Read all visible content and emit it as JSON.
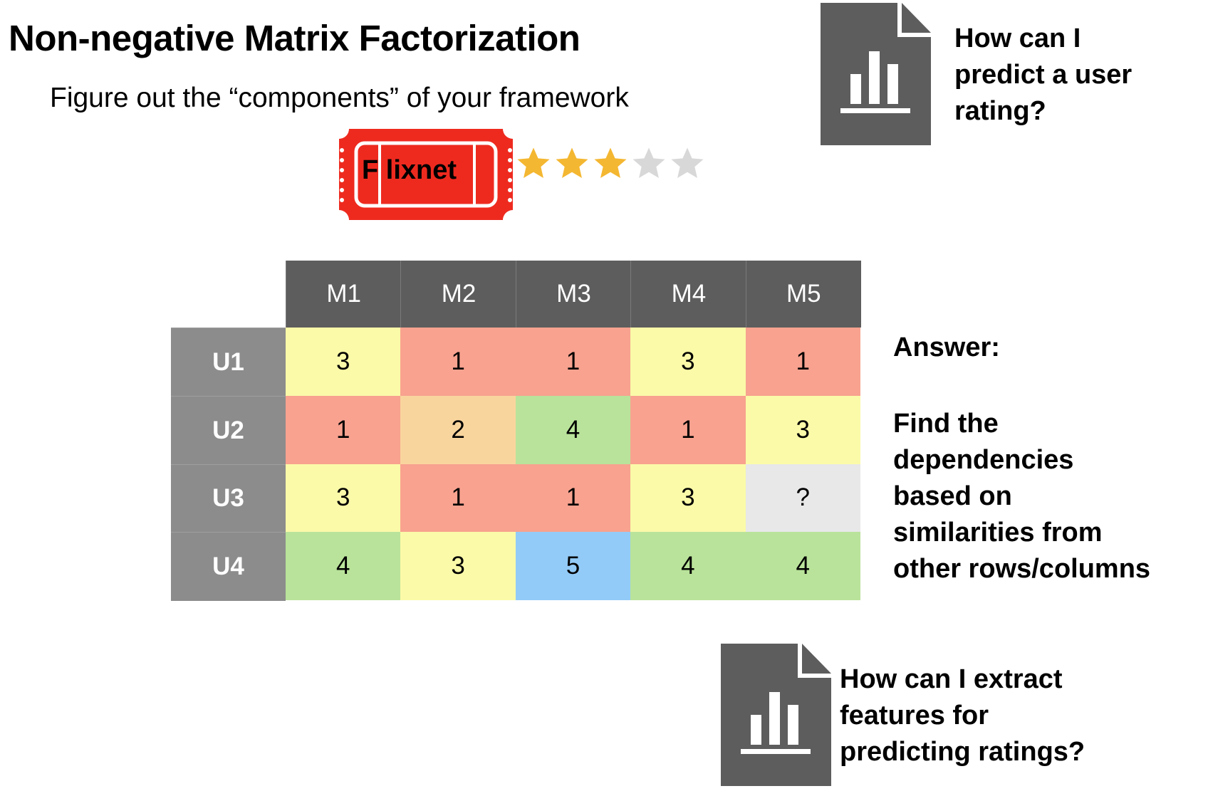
{
  "title": "Non-negative Matrix Factorization",
  "subtitle": "Figure out the “components” of your framework",
  "logo": {
    "text": "F lixnet",
    "color": "#ee2a1f"
  },
  "rating": {
    "stars_filled": 3,
    "stars_total": 5,
    "filled_color": "#f4b731",
    "empty_color": "#d8d8d8"
  },
  "question_top": [
    "How can I",
    "predict a user",
    "rating?"
  ],
  "question_bottom": [
    "How can I extract",
    "features for",
    "predicting ratings?"
  ],
  "answer": {
    "label": "Answer:",
    "lines": [
      "Find the",
      "dependencies",
      "based on",
      "similarities from",
      "other rows/columns"
    ]
  },
  "matrix": {
    "columns": [
      "M1",
      "M2",
      "M3",
      "M4",
      "M5"
    ],
    "rows": [
      {
        "label": "U1",
        "values": [
          "3",
          "1",
          "1",
          "3",
          "1"
        ]
      },
      {
        "label": "U2",
        "values": [
          "1",
          "2",
          "4",
          "1",
          "3"
        ]
      },
      {
        "label": "U3",
        "values": [
          "3",
          "1",
          "1",
          "3",
          "?"
        ]
      },
      {
        "label": "U4",
        "values": [
          "4",
          "3",
          "5",
          "4",
          "4"
        ]
      }
    ],
    "value_colors": {
      "1": "#f8a28f",
      "2": "#f9d59e",
      "3": "#fbfaa8",
      "4": "#b9e39a",
      "5": "#93cbf8",
      "?": "#e8e8e8"
    },
    "header_color": "#5d5d5d",
    "row_header_color": "#8c8c8c"
  }
}
